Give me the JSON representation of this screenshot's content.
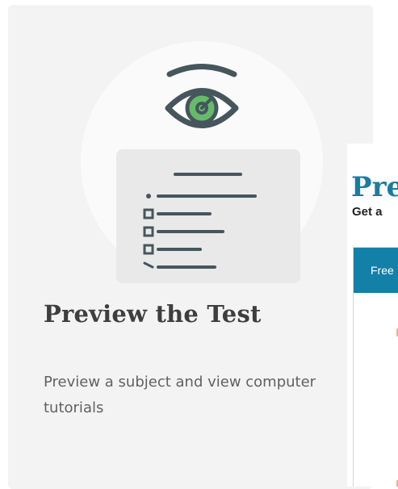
{
  "card": {
    "title": "Preview the Test",
    "description": "Preview a subject and view computer tutorials",
    "illustration": {
      "icons": [
        "eye-icon",
        "checklist-icon"
      ],
      "colors": {
        "circle": "#fafafa",
        "sheet": "#e9e9e9",
        "stroke": "#46565d",
        "iris": "#66bb6a"
      }
    }
  },
  "panel": {
    "title": "Pre",
    "subtitle": "Get a",
    "tab_label": "Free",
    "colors": {
      "title": "#1a7ca0",
      "tab": "#1380a8"
    }
  }
}
